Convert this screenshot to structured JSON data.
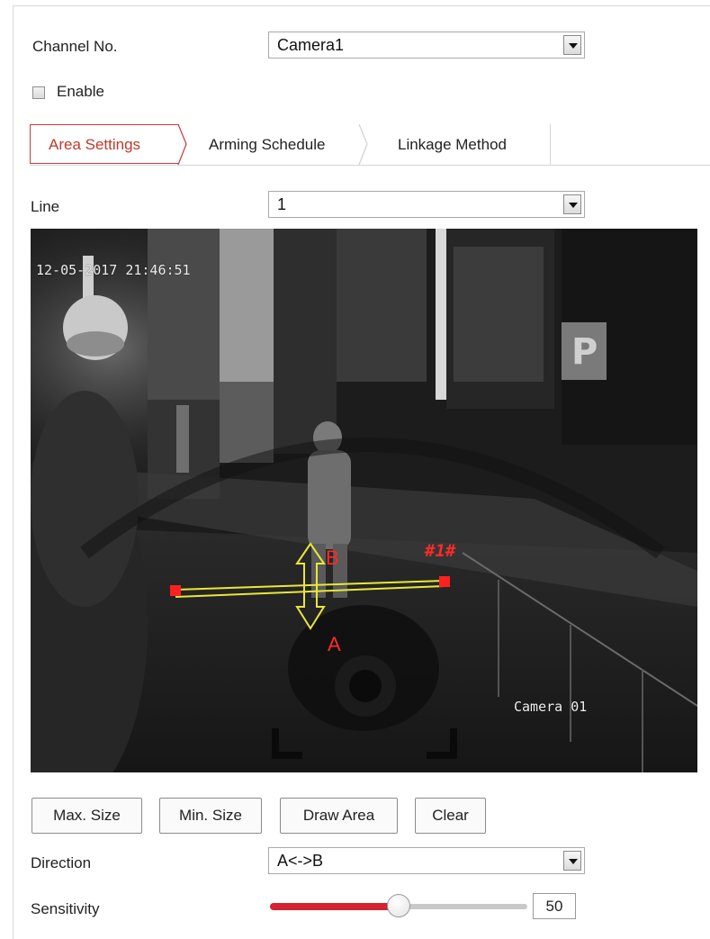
{
  "channel": {
    "label": "Channel No.",
    "value": "Camera1"
  },
  "enable": {
    "label": "Enable",
    "checked": false
  },
  "tabs": [
    {
      "label": "Area Settings",
      "active": true
    },
    {
      "label": "Arming Schedule",
      "active": false
    },
    {
      "label": "Linkage Method",
      "active": false
    }
  ],
  "line": {
    "label": "Line",
    "value": "1"
  },
  "video": {
    "timestamp": "12-05-2017 21:46:51",
    "camera_name": "Camera 01",
    "line_id": "#1#",
    "direction_label_a": "A",
    "direction_label_b": "B"
  },
  "buttons": {
    "max_size": "Max. Size",
    "min_size": "Min. Size",
    "draw_area": "Draw Area",
    "clear": "Clear"
  },
  "direction": {
    "label": "Direction",
    "value": "A<->B"
  },
  "sensitivity": {
    "label": "Sensitivity",
    "value": "50",
    "percent": 50
  },
  "colors": {
    "accent": "#c83a3a",
    "overlay_line": "#e8e83a",
    "overlay_endpoint": "#ff2020"
  }
}
